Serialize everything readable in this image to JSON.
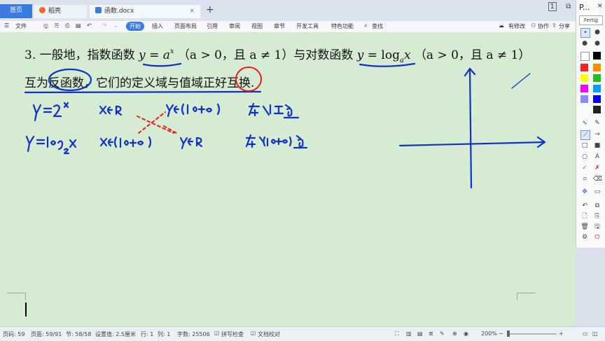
{
  "tabs": {
    "home": "首页",
    "daoke": "稻壳",
    "document": "函数.docx",
    "add": "+",
    "close": "×"
  },
  "window_controls": {
    "badge": "1",
    "restore": "⧉",
    "minimize": "—",
    "close": "✕"
  },
  "menubar": {
    "file": "文件",
    "start": "开始",
    "insert": "插入",
    "layout": "页面布局",
    "reference": "引用",
    "review": "审阅",
    "view": "视图",
    "chapter": "章节",
    "devtools": "开发工具",
    "features": "特色功能",
    "search": "查找",
    "track_changes": "有修改",
    "collab": "协作",
    "share": "分享"
  },
  "right_panel": {
    "title": "P...",
    "mode": "Fertig",
    "colors": [
      "#ffffff",
      "#000000",
      "#ff2020",
      "#ff8c00",
      "#ffff00",
      "#20c020",
      "#ff00ff",
      "#00a0ff",
      "#8888ff",
      "#0000ff",
      "#222222"
    ]
  },
  "document": {
    "line1": {
      "num": "3.",
      "text_a": "一般地，指数函数",
      "y": "y",
      "eq": "=",
      "a": "a",
      "x": "x",
      "cond1": "（a > 0，且 a ≠ 1）",
      "text_b": "与对数函数",
      "log": "log",
      "cond2": "（a > 0，且 a ≠ 1）"
    },
    "line2": {
      "text": "互为反函数，它们的定义域与值域正好互换."
    }
  },
  "statusbar": {
    "page_num": "页码: 59",
    "pages": "页面: 59/91",
    "section": "节: 58/58",
    "setting": "设置值: 2.5厘米",
    "row": "行: 1",
    "col": "列: 1",
    "words": "字数: 25506",
    "spell": "拼写检查",
    "proof": "文档校对",
    "zoom": "200%",
    "minus": "−",
    "plus": "+"
  }
}
